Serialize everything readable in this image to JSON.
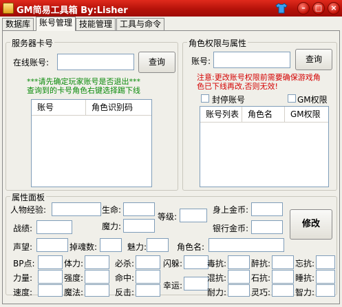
{
  "window": {
    "title": "GM简易工具箱   By:Lisher"
  },
  "tabs": [
    {
      "label": "数据库"
    },
    {
      "label": "账号管理"
    },
    {
      "label": "技能管理"
    },
    {
      "label": "工具与命令"
    }
  ],
  "server_card": {
    "title": "服务器卡号",
    "online_account_label": "在线账号:",
    "online_account_value": "",
    "query_button": "查询",
    "notice_line1": "***请先确定玩家账号是否退出***",
    "notice_line2": "查询到的卡号角色右键选择踢下线",
    "list_columns": [
      "账号",
      "角色识别码"
    ]
  },
  "role_perms": {
    "title": "角色权限与属性",
    "account_label": "账号:",
    "account_value": "",
    "query_button": "查询",
    "warning_line1": "注意:更改账号权限前需要确保游戏角",
    "warning_line2": "色已下线再改,否则无效!",
    "ban_checkbox": "封停账号",
    "gm_checkbox": "GM权限",
    "list_columns": [
      "账号列表",
      "角色名",
      "GM权限"
    ]
  },
  "attr_panel": {
    "title": "属性面板",
    "labels": {
      "exp": "人物经验:",
      "life": "生命:",
      "level": "等级:",
      "body_gold": "身上金币:",
      "merit": "战绩:",
      "mana": "魔力:",
      "bank_gold": "银行金币:",
      "fame": "声望:",
      "soul_drop": "掉魂数:",
      "charm": "魅力:",
      "role_name": "角色名:",
      "bp": "BP点:",
      "stamina": "体力:",
      "crit": "必杀:",
      "dodge": "闪躲:",
      "poison_res": "毒抗:",
      "drunk_res": "醉抗:",
      "forget_res": "忘抗:",
      "strength": "力量:",
      "toughness": "强度:",
      "hit": "命中:",
      "chaos_res": "混抗:",
      "stone_res": "石抗:",
      "sleep_res": "睡抗:",
      "speed": "速度:",
      "magic": "魔法:",
      "counter": "反击:",
      "luck": "幸运:",
      "endurance": "耐力:",
      "spirit": "灵巧:",
      "intellect": "智力:"
    },
    "modify_button": "修改"
  },
  "colors": {
    "titlebar": "#c0160c",
    "notice_green": "#0a8a0a",
    "warning_red": "#d40000"
  }
}
